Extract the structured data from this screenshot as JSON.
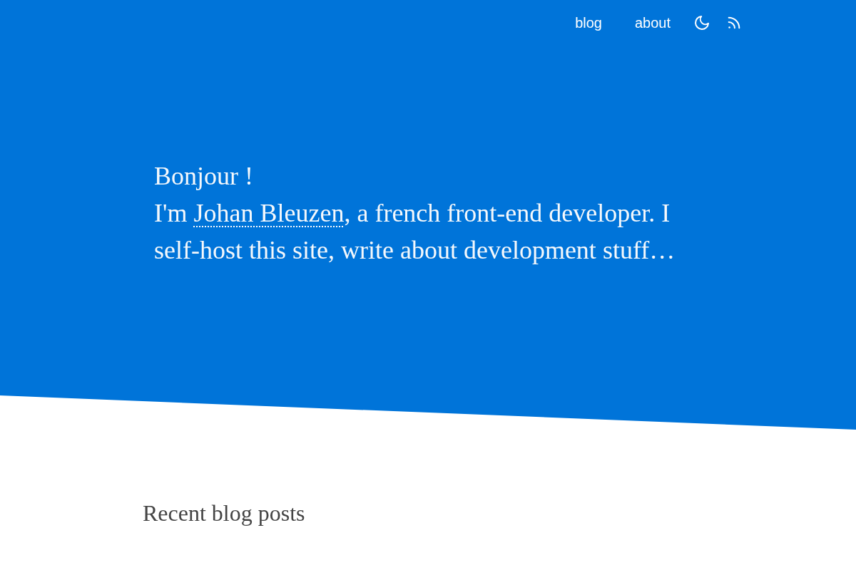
{
  "nav": {
    "links": [
      "blog",
      "about"
    ]
  },
  "hero": {
    "greeting": "Bonjour !",
    "intro": {
      "before": "I'm ",
      "link": "Johan Bleuzen",
      "after": ", a french front-end developer. I self-host this site, write about development stuff…"
    }
  },
  "recent_posts": {
    "title": "Recent blog posts"
  }
}
